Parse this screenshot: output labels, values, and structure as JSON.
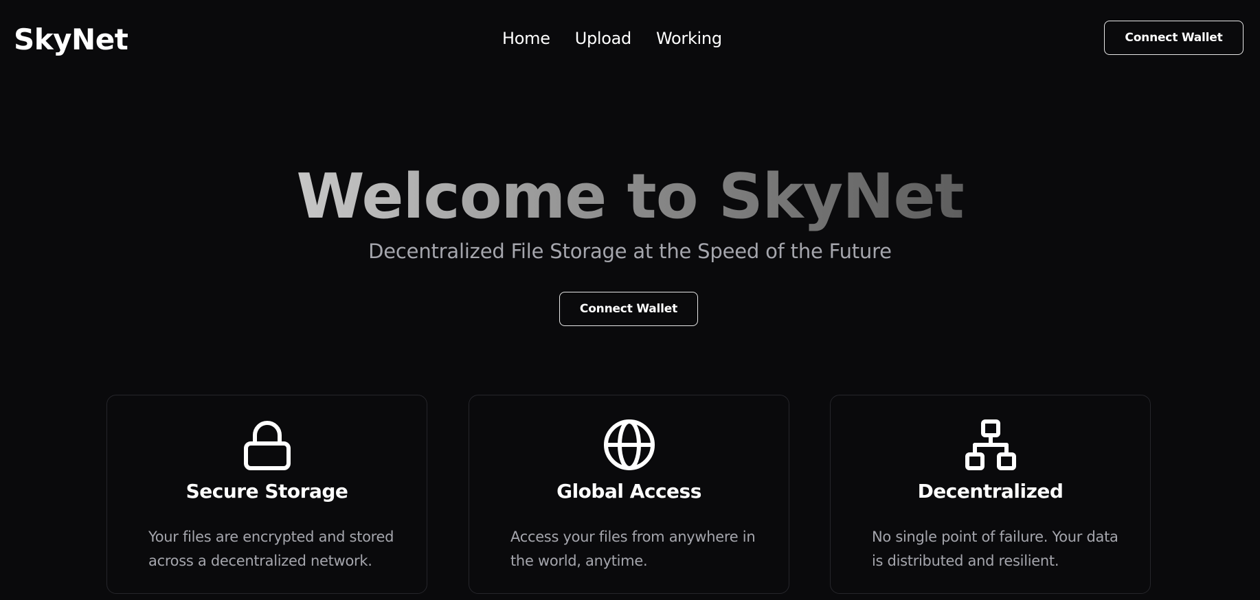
{
  "brand": {
    "logo": "SkyNet"
  },
  "nav": {
    "links": [
      "Home",
      "Upload",
      "Working"
    ],
    "connect_label": "Connect Wallet"
  },
  "hero": {
    "title": "Welcome to SkyNet",
    "subtitle": "Decentralized File Storage at the Speed of the Future",
    "connect_label": "Connect Wallet"
  },
  "features": [
    {
      "icon": "lock-icon",
      "title": "Secure Storage",
      "description": "Your files are encrypted and stored across a decentralized network."
    },
    {
      "icon": "globe-icon",
      "title": "Global Access",
      "description": "Access your files from anywhere in the world, anytime."
    },
    {
      "icon": "network-icon",
      "title": "Decentralized",
      "description": "No single point of failure. Your data is distributed and resilient."
    }
  ],
  "colors": {
    "background": "#0a0a0c",
    "text": "#ffffff",
    "muted_text": "#a5a6ad",
    "card_border": "#26262b",
    "button_border": "#e8e8e8"
  }
}
